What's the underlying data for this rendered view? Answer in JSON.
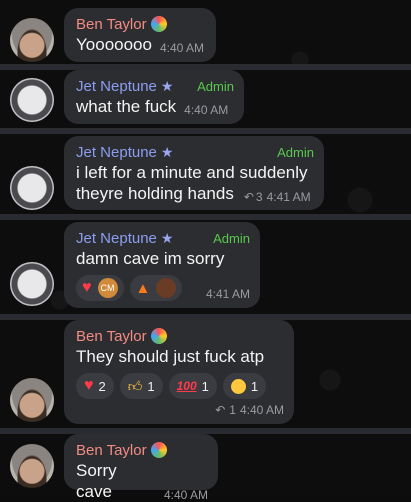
{
  "messages": [
    {
      "sender": "Ben Taylor",
      "text": "Yooooooo",
      "time": "4:40 AM"
    },
    {
      "sender": "Jet Neptune",
      "badge": "Admin",
      "text": "what the fuck",
      "time": "4:40 AM"
    },
    {
      "sender": "Jet Neptune",
      "badge": "Admin",
      "text_line1": "i left for a minute and suddenly",
      "text_line2": "theyre holding hands",
      "replies": "3",
      "time": "4:41 AM"
    },
    {
      "sender": "Jet Neptune",
      "badge": "Admin",
      "text": "damn cave im sorry",
      "time": "4:41 AM",
      "reaction_initials": "CM"
    },
    {
      "sender": "Ben Taylor",
      "text": "They should just fuck atp",
      "time": "4:40 AM",
      "replies": "1",
      "reactions": [
        {
          "icon": "heart-icon",
          "count": "2"
        },
        {
          "icon": "thumbs-up-icon",
          "count": "1"
        },
        {
          "icon": "hundred-icon",
          "count": "1"
        },
        {
          "icon": "laughing-face-icon",
          "count": "1"
        }
      ]
    },
    {
      "sender": "Ben Taylor",
      "text": "Sorry cave",
      "time": "4:40 AM"
    }
  ],
  "colors": {
    "ben_name": "#f28b82",
    "jet_name": "#8c9df0",
    "admin": "#57c84d",
    "bubble": "#2c2d31"
  }
}
